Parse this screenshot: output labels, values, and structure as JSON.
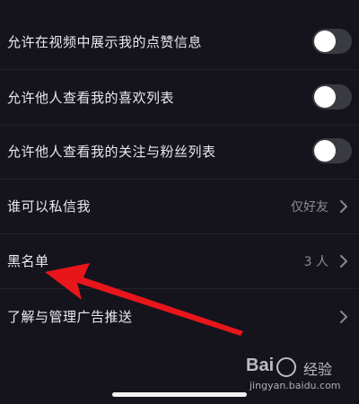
{
  "colors": {
    "background": "#15141d",
    "toggle_off": "#3a3a42",
    "annotation_arrow": "#e8151b"
  },
  "settings": {
    "rows": [
      {
        "label": "允许在视频中展示我的点赞信息",
        "control": "toggle",
        "state": "off"
      },
      {
        "label": "允许他人查看我的喜欢列表",
        "control": "toggle",
        "state": "off"
      },
      {
        "label": "允许他人查看我的关注与粉丝列表",
        "control": "toggle",
        "state": "off"
      },
      {
        "label": "谁可以私信我",
        "value": "仅好友",
        "control": "chevron-right-icon"
      },
      {
        "label": "黑名单",
        "value": "3 人",
        "control": "chevron-right-icon"
      },
      {
        "label": "了解与管理广告推送",
        "control": "chevron-right-icon"
      }
    ]
  },
  "watermark": {
    "brand": "Bai",
    "brand_cn": "经验",
    "url": "jingyan.baidu.com"
  }
}
